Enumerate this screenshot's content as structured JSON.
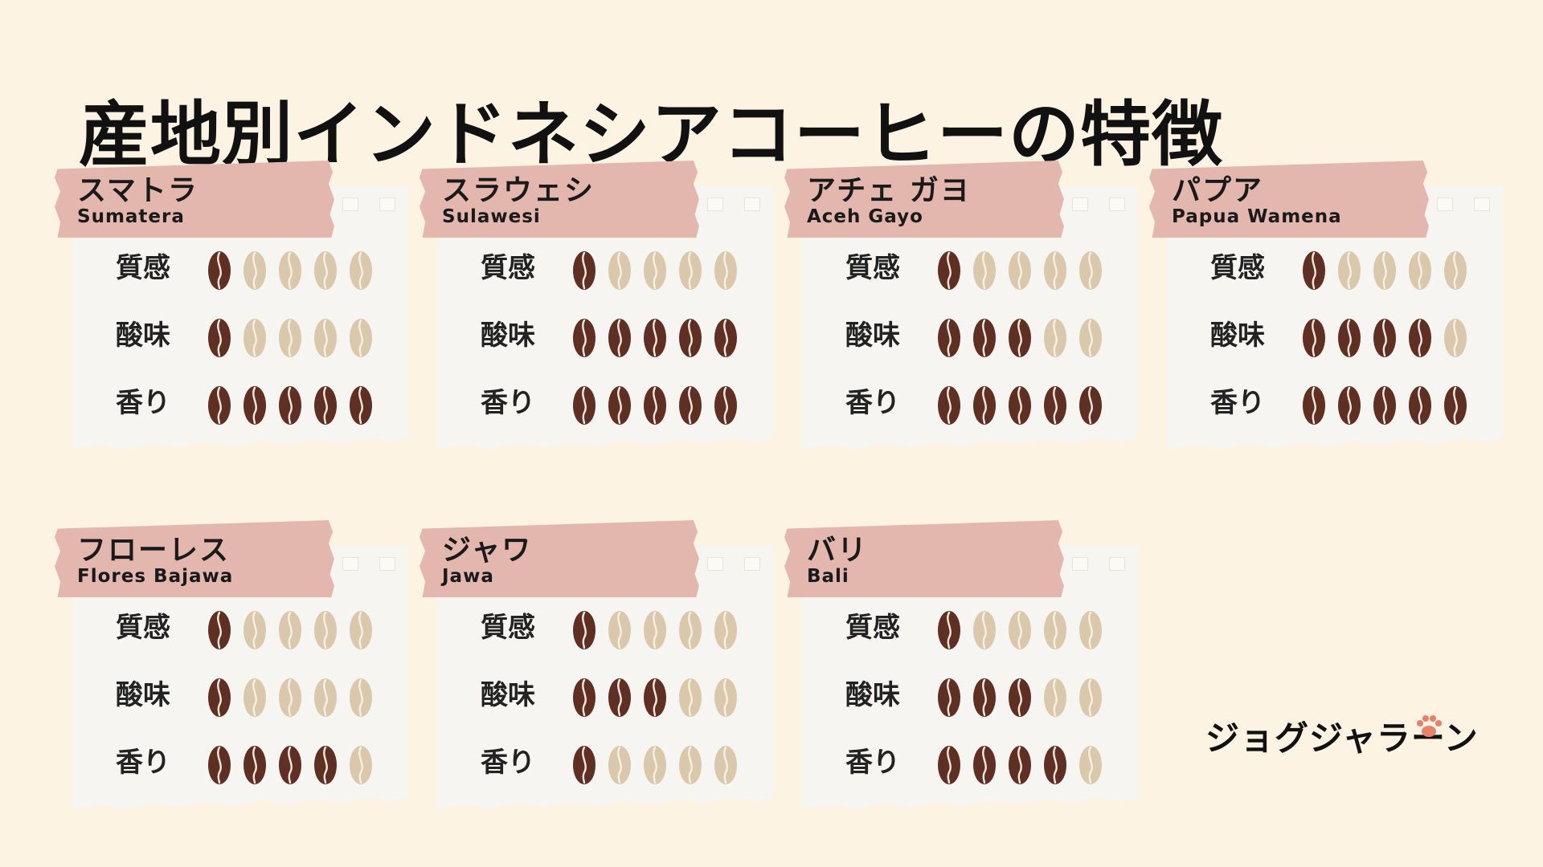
{
  "title": "産地別インドネシアコーヒーの特徴",
  "logo_text": "ジョグジャラーン",
  "paw_icon": "paw-icon",
  "bean_icon": "coffee-bean-icon",
  "colors": {
    "background": "#fdf3e2",
    "banner": "#e3b7ae",
    "bean_filled": "#5e2f22",
    "bean_empty": "#dac8ad",
    "paw": "#e8816a"
  },
  "attribute_labels": [
    "質感",
    "酸味",
    "香り"
  ],
  "max_score": 5,
  "regions": [
    {
      "name_ja": "スマトラ",
      "name_en": "Sumatera",
      "scores": [
        1,
        1,
        5
      ]
    },
    {
      "name_ja": "スラウェシ",
      "name_en": "Sulawesi",
      "scores": [
        1,
        5,
        5
      ]
    },
    {
      "name_ja": "アチェ ガヨ",
      "name_en": "Aceh Gayo",
      "scores": [
        1,
        3,
        5
      ]
    },
    {
      "name_ja": "パプア",
      "name_en": "Papua Wamena",
      "scores": [
        1,
        4,
        5
      ]
    },
    {
      "name_ja": "フローレス",
      "name_en": "Flores Bajawa",
      "scores": [
        1,
        1,
        4
      ]
    },
    {
      "name_ja": "ジャワ",
      "name_en": "Jawa",
      "scores": [
        1,
        3,
        1
      ]
    },
    {
      "name_ja": "バリ",
      "name_en": "Bali",
      "scores": [
        1,
        3,
        4
      ]
    }
  ]
}
